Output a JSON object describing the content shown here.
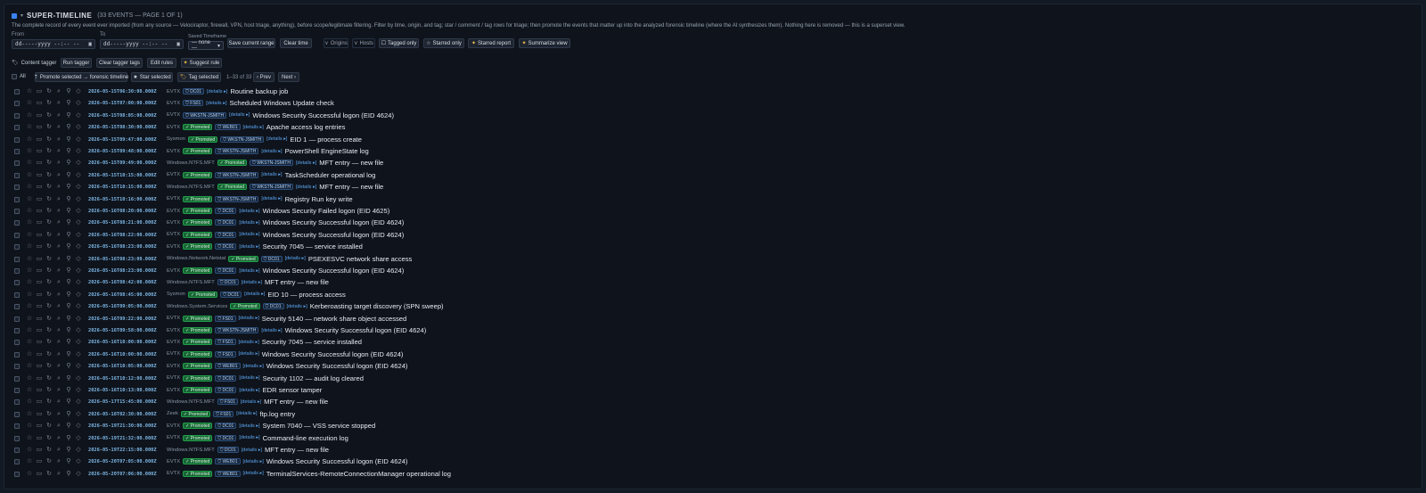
{
  "header": {
    "title": "SUPER-TIMELINE",
    "subtitle": "(33 EVENTS — PAGE 1 OF 1)",
    "description": "The complete record of every event ever imported (from any source — Velociraptor, firewall, VPN, host triage, anything), before scope/legitimate filtering. Filter by time, origin, and tag; star / comment / tag rows for triage; then promote the events that matter up into the analyzed forensic timeline (where the AI synthesizes them). Nothing here is removed — this is a superset view."
  },
  "filters": {
    "from_label": "From",
    "to_label": "To",
    "from_value": "dd-----yyyy --:-- --",
    "to_value": "dd-----yyyy --:-- --",
    "saved_label": "Saved Timeframe",
    "saved_value": "— none —",
    "save_range": "Save current range",
    "clear_time": "Clear time",
    "origins": "Origins",
    "hosts": "Hosts",
    "tagged_only": "Tagged only",
    "starred_only": "Starred only",
    "starred_report": "Starred report",
    "summarize_view": "Summarize view"
  },
  "tagger": {
    "label": "Content tagger",
    "run": "Run tagger",
    "clear": "Clear tagger tags",
    "edit": "Edit rules",
    "suggest": "Suggest rule"
  },
  "bulk": {
    "all": "All",
    "promote": "Promote selected → forensic timeline",
    "star": "Star selected",
    "tag": "Tag selected",
    "range": "1–33 of 33",
    "prev": "‹ Prev",
    "next": "Next ›"
  },
  "details_label": "[details ▸]",
  "promoted_label": "✓ Promoted",
  "rows": [
    {
      "ts": "2026-05-15T06:30:00.000Z",
      "src": "EVTX",
      "promoted": false,
      "host": "DC01",
      "event": "Routine backup job"
    },
    {
      "ts": "2026-05-15T07:00:00.000Z",
      "src": "EVTX",
      "promoted": false,
      "host": "FS01",
      "event": "Scheduled Windows Update check"
    },
    {
      "ts": "2026-05-15T08:05:00.000Z",
      "src": "EVTX",
      "promoted": false,
      "host": "WKSTN-JSMITH",
      "event": "Windows Security Successful logon (EID 4624)"
    },
    {
      "ts": "2026-05-15T08:30:00.000Z",
      "src": "EVTX",
      "promoted": true,
      "host": "WEB01",
      "event": "Apache access log entries"
    },
    {
      "ts": "2026-05-15T09:47:00.000Z",
      "src": "Sysmon",
      "promoted": true,
      "host": "WKSTN-JSMITH",
      "event": "EID 1 — process create"
    },
    {
      "ts": "2026-05-15T09:48:00.000Z",
      "src": "EVTX",
      "promoted": true,
      "host": "WKSTN-JSMITH",
      "event": "PowerShell EngineState log"
    },
    {
      "ts": "2026-05-15T09:49:00.000Z",
      "src": "Windows.NTFS.MFT",
      "promoted": true,
      "host": "WKSTN-JSMITH",
      "event": "MFT entry — new file"
    },
    {
      "ts": "2026-05-15T10:15:00.000Z",
      "src": "EVTX",
      "promoted": true,
      "host": "WKSTN-JSMITH",
      "event": "TaskScheduler operational log"
    },
    {
      "ts": "2026-05-15T10:15:00.000Z",
      "src": "Windows.NTFS.MFT",
      "promoted": true,
      "host": "WKSTN-JSMITH",
      "event": "MFT entry — new file"
    },
    {
      "ts": "2026-05-15T10:16:00.000Z",
      "src": "EVTX",
      "promoted": true,
      "host": "WKSTN-JSMITH",
      "event": "Registry Run key write"
    },
    {
      "ts": "2026-05-16T08:20:00.000Z",
      "src": "EVTX",
      "promoted": true,
      "host": "DC01",
      "event": "Windows Security Failed logon (EID 4625)"
    },
    {
      "ts": "2026-05-16T08:21:00.000Z",
      "src": "EVTX",
      "promoted": true,
      "host": "DC01",
      "event": "Windows Security Successful logon (EID 4624)"
    },
    {
      "ts": "2026-05-16T08:22:00.000Z",
      "src": "EVTX",
      "promoted": true,
      "host": "DC01",
      "event": "Windows Security Successful logon (EID 4624)"
    },
    {
      "ts": "2026-05-16T08:23:00.000Z",
      "src": "EVTX",
      "promoted": true,
      "host": "DC01",
      "event": "Security 7045 — service installed"
    },
    {
      "ts": "2026-05-16T08:23:00.000Z",
      "src": "Windows.Network.Netstat",
      "promoted": true,
      "host": "DC01",
      "event": "PSEXESVC network share access"
    },
    {
      "ts": "2026-05-16T08:23:00.000Z",
      "src": "EVTX",
      "promoted": true,
      "host": "DC01",
      "event": "Windows Security Successful logon (EID 4624)"
    },
    {
      "ts": "2026-05-16T08:42:00.000Z",
      "src": "Windows.NTFS.MFT",
      "promoted": false,
      "host": "DC01",
      "event": "MFT entry — new file"
    },
    {
      "ts": "2026-05-16T08:45:00.000Z",
      "src": "Sysmon",
      "promoted": true,
      "host": "DC01",
      "event": "EID 10 — process access"
    },
    {
      "ts": "2026-05-16T09:05:00.000Z",
      "src": "Windows.System.Services",
      "promoted": true,
      "host": "DC01",
      "event": "Kerberoasting target discovery (SPN sweep)"
    },
    {
      "ts": "2026-05-16T09:22:00.000Z",
      "src": "EVTX",
      "promoted": true,
      "host": "FS01",
      "event": "Security 5140 — network share object accessed"
    },
    {
      "ts": "2026-05-16T09:58:00.000Z",
      "src": "EVTX",
      "promoted": true,
      "host": "WKSTN-JSMITH",
      "event": "Windows Security Successful logon (EID 4624)"
    },
    {
      "ts": "2026-05-16T10:00:00.000Z",
      "src": "EVTX",
      "promoted": true,
      "host": "FS01",
      "event": "Security 7045 — service installed"
    },
    {
      "ts": "2026-05-16T10:00:00.000Z",
      "src": "EVTX",
      "promoted": true,
      "host": "FS01",
      "event": "Windows Security Successful logon (EID 4624)"
    },
    {
      "ts": "2026-05-16T10:05:00.000Z",
      "src": "EVTX",
      "promoted": true,
      "host": "WEB01",
      "event": "Windows Security Successful logon (EID 4624)"
    },
    {
      "ts": "2026-05-16T10:12:00.000Z",
      "src": "EVTX",
      "promoted": true,
      "host": "DC01",
      "event": "Security 1102 — audit log cleared"
    },
    {
      "ts": "2026-05-16T10:13:00.000Z",
      "src": "EVTX",
      "promoted": true,
      "host": "DC01",
      "event": "EDR sensor tamper"
    },
    {
      "ts": "2026-05-17T15:45:00.000Z",
      "src": "Windows.NTFS.MFT",
      "promoted": false,
      "host": "FS01",
      "event": "MFT entry — new file"
    },
    {
      "ts": "2026-05-18T02:30:00.000Z",
      "src": "Zeek",
      "promoted": true,
      "host": "FS01",
      "event": "ftp.log entry"
    },
    {
      "ts": "2026-05-19T21:30:00.000Z",
      "src": "EVTX",
      "promoted": true,
      "host": "DC01",
      "event": "System 7040 — VSS service stopped"
    },
    {
      "ts": "2026-05-19T21:32:00.000Z",
      "src": "EVTX",
      "promoted": true,
      "host": "DC01",
      "event": "Command-line execution log"
    },
    {
      "ts": "2026-05-19T22:15:00.000Z",
      "src": "Windows.NTFS.MFT",
      "promoted": false,
      "host": "DC01",
      "event": "MFT entry — new file"
    },
    {
      "ts": "2026-05-20T07:05:00.000Z",
      "src": "EVTX",
      "promoted": true,
      "host": "WEB01",
      "event": "Windows Security Successful logon (EID 4624)"
    },
    {
      "ts": "2026-05-20T07:06:00.000Z",
      "src": "EVTX",
      "promoted": true,
      "host": "WEB01",
      "event": "TerminalServices-RemoteConnectionManager operational log"
    }
  ]
}
